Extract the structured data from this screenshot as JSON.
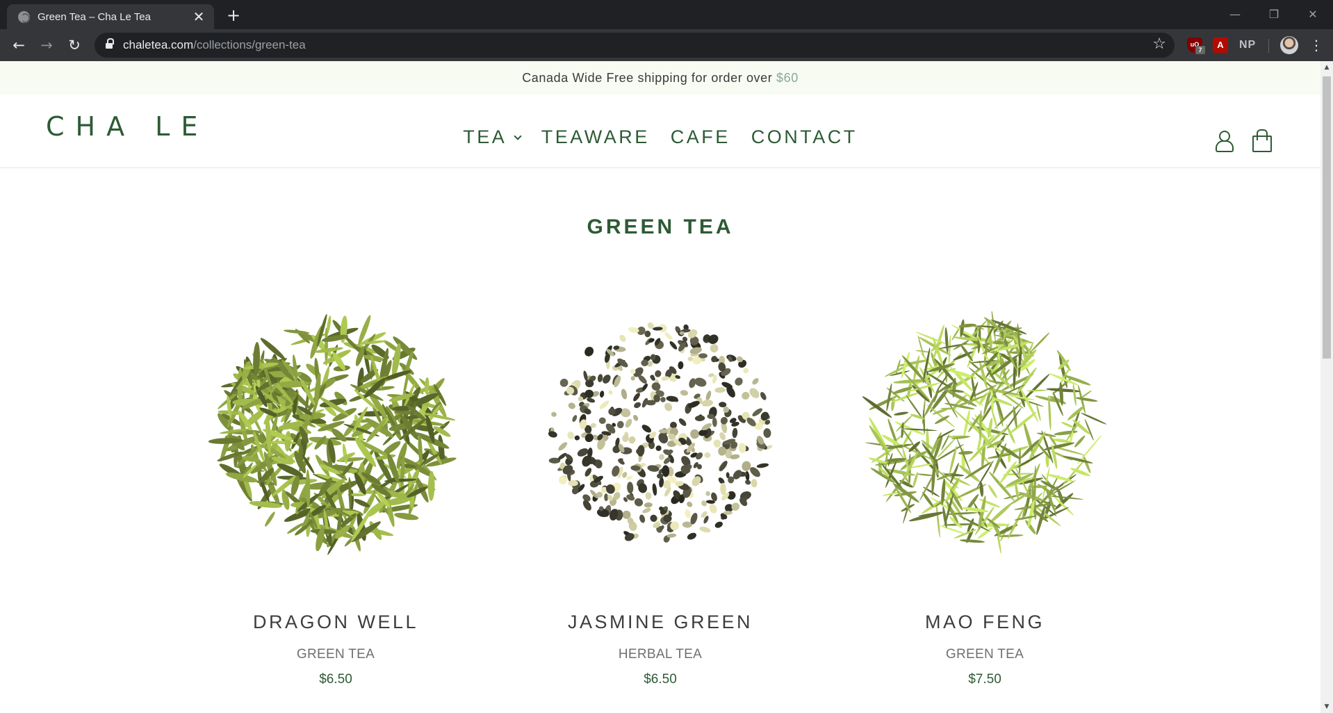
{
  "browser": {
    "tab_title": "Green Tea – Cha Le Tea",
    "tab_close": "✕",
    "new_tab": "+",
    "back": "←",
    "forward": "→",
    "reload": "↻",
    "url_host": "chaletea.com",
    "url_path": "/collections/green-tea",
    "star": "☆",
    "ext_ublock": "uO",
    "ext_ublock_badge": "7",
    "ext_pdf": "A",
    "ext_np": "NP",
    "menu": "⋮",
    "minimize": "—",
    "restore": "❐",
    "close": "✕"
  },
  "announcement": {
    "text": "Canada Wide Free shipping for order over ",
    "amount": "$60"
  },
  "header": {
    "logo": "CHA LE",
    "nav": [
      {
        "label": "TEA",
        "has_dropdown": true
      },
      {
        "label": "TEAWARE"
      },
      {
        "label": "CAFE"
      },
      {
        "label": "CONTACT"
      }
    ]
  },
  "collection": {
    "title": "GREEN TEA",
    "products": [
      {
        "name": "DRAGON WELL",
        "type": "GREEN TEA",
        "price": "$6.50",
        "leaf_color": "#7c8f3a"
      },
      {
        "name": "JASMINE GREEN",
        "type": "HERBAL TEA",
        "price": "$6.50",
        "leaf_color": "#5b5a48"
      },
      {
        "name": "MAO FENG",
        "type": "GREEN TEA",
        "price": "$7.50",
        "leaf_color": "#8fa64a"
      }
    ]
  },
  "colors": {
    "brand_green": "#2d5a35",
    "announcement_bg": "#f8fbf2",
    "chrome_dark": "#35363a"
  }
}
